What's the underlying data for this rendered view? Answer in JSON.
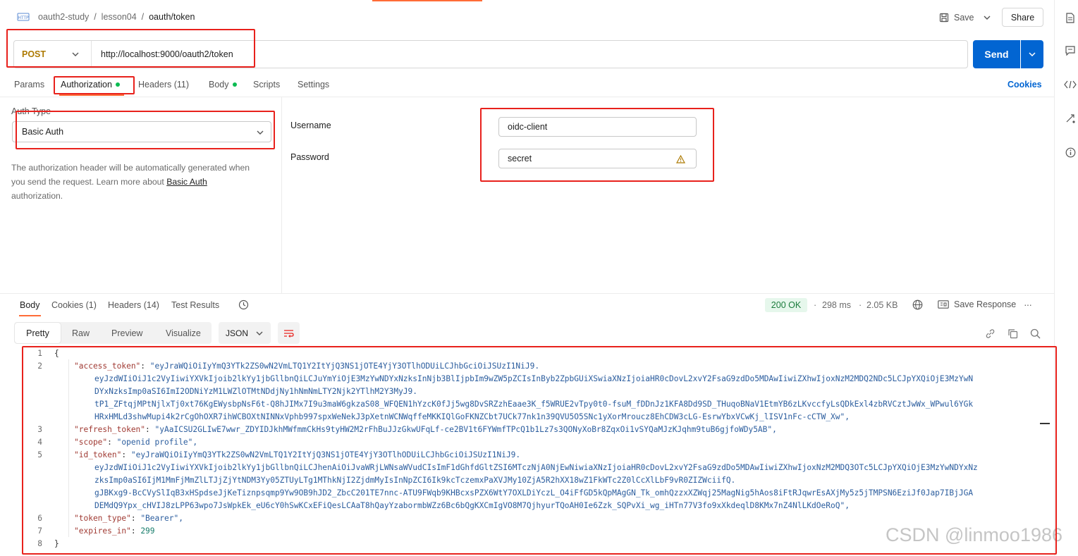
{
  "breadcrumb": {
    "collection": "oauth2-study",
    "folder": "lesson04",
    "request": "oauth/token",
    "http_badge": "HTTP"
  },
  "header": {
    "save_label": "Save",
    "share_label": "Share"
  },
  "request": {
    "method": "POST",
    "url": "http://localhost:9000/oauth2/token",
    "send_label": "Send"
  },
  "request_tabs": {
    "params": "Params",
    "authorization": "Authorization",
    "headers": "Headers (11)",
    "body": "Body",
    "scripts": "Scripts",
    "settings": "Settings",
    "cookies": "Cookies"
  },
  "auth": {
    "type_label": "Auth Type",
    "type_value": "Basic Auth",
    "description_1": "The authorization header will be automatically generated when",
    "description_2": "you send the request. Learn more about ",
    "description_link": "Basic Auth",
    "description_3": "authorization.",
    "username_label": "Username",
    "username_value": "oidc-client",
    "password_label": "Password",
    "password_value": "secret"
  },
  "response_tabs": {
    "body": "Body",
    "cookies": "Cookies (1)",
    "headers": "Headers (14)",
    "test_results": "Test Results"
  },
  "response_meta": {
    "status": "200 OK",
    "time": "298 ms",
    "size": "2.05 KB",
    "save_response": "Save Response",
    "more": "···"
  },
  "view_modes": {
    "pretty": "Pretty",
    "raw": "Raw",
    "preview": "Preview",
    "visualize": "Visualize",
    "format": "JSON"
  },
  "code": {
    "l1": "{",
    "access_token_key": "\"access_token\"",
    "access_token_1": "\"eyJraWQiOiIyYmQ3YTk2ZS0wN2VmLTQ1Y2ItYjQ3NS1jOTE4YjY3OTlhODUiLCJhbGciOiJSUzI1NiJ9.",
    "access_token_2": "eyJzdWIiOiJ1c2VyIiwiYXVkIjoib2lkYy1jbGllbnQiLCJuYmYiOjE3MzYwNDYxNzksInNjb3BlIjpbIm9wZW5pZCIsInByb2ZpbGUiXSwiaXNzIjoiaHR0cDovL2xvY2FsaG9zdDo5MDAwIiwiZXhwIjoxNzM2MDQ2NDc5LCJpYXQiOjE3MzYwN",
    "access_token_3": "DYxNzksImp0aSI6ImI2ODNiYzM1LWZlOTMtNDdjNy1hNmNmLTY2Njk2YTlhM2Y3MyJ9.",
    "access_token_4": "tP1_ZFtqjMPtNjlxTj0xt76KgEWysbpNsF6t-Q8hJIMx7I9u3maW6gkzaS08_WFQEN1hYzcK0fJj5wg8DvSRZzhEaae3K_f5WRUE2vTpy0t0-fsuM_fDDnJz1KFA8Dd9SD_THuqoBNaV1EtmYB6zLKvccfyLsQDkExl4zbRVCztJwWx_WPwul6YGk",
    "access_token_5": "HRxHMLd3shwMupi4k2rCgOhOXR7ihWCBOXtNINNxVphb997spxWeNekJ3pXetnWCNWqffeMKKIQlGoFKNZCbt7UCk77nk1n39QVU5O5SNc1yXorMroucz8EhCDW3cLG-EsrwYbxVCwKj_lISV1nFc-cCTW_Xw\",",
    "refresh_token_key": "\"refresh_token\"",
    "refresh_token": "\"yAaICSU2GLIwE7wwr_ZDYIDJkhMWfmmCkHs9tyHW2M2rFhBuJJzGkwUFqLf-ce2BV1t6FYWmfTPcQ1b1Lz7s3QONyXoBr8ZqxOi1vSYQaMJzKJqhm9tuB6gjfoWDy5AB\",",
    "scope_key": "\"scope\"",
    "scope": "\"openid profile\",",
    "id_token_key": "\"id_token\"",
    "id_token_1": "\"eyJraWQiOiIyYmQ3YTk2ZS0wN2VmLTQ1Y2ItYjQ3NS1jOTE4YjY3OTlhODUiLCJhbGciOiJSUzI1NiJ9.",
    "id_token_2": "eyJzdWIiOiJ1c2VyIiwiYXVkIjoib2lkYy1jbGllbnQiLCJhenAiOiJvaWRjLWNsaWVudCIsImF1dGhfdGltZSI6MTczNjA0NjEwNiwiaXNzIjoiaHR0cDovL2xvY2FsaG9zdDo5MDAwIiwiZXhwIjoxNzM2MDQ3OTc5LCJpYXQiOjE3MzYwNDYxNz",
    "id_token_3": "zksImp0aSI6IjM1MmFjMmZlLTJjZjYtNDM3Yy05ZTUyLTg1MThkNjI2ZjdmMyIsInNpZCI6Ik9kcTczemxPaXVJMy10ZjA5R2hXX18wZ1FkWTc2Z0lCcXlLbF9vR0ZIZWciifQ.",
    "id_token_4": "gJBKxg9-BcCVySlIqB3xHSpdseJjKeTiznpsqmp9Yw9OB9hJD2_ZbcC201TE7nnc-ATU9FWqb9KHBcxsPZX6WtY7OXLDiYczL_O4iFfGD5kQpMAgGN_Tk_omhQzzxXZWqj25MagNig5hAos8iFtRJqwrEsAXjMy5z5jTMPSN6EziJf0Jap7IBjJGA",
    "id_token_5": "DEMdQ9Ypx_cHVIJ8zLPP63wpo7JsWpkEk_eU6cY0hSwKCxEFiQesLCAaT8hQayYzabormbWZz6Bc6bQgKXCmIgVO8M7QjhyurTQoAH0Ie6Zzk_SQPvXi_wg_iHTn77V3fo9xXkdeqlD8KMx7nZ4NlLKdOeRoQ\",",
    "token_type_key": "\"token_type\"",
    "token_type": "\"Bearer\",",
    "expires_in_key": "\"expires_in\"",
    "expires_in": "299",
    "l8": "}"
  },
  "line_numbers": [
    "1",
    "2",
    "3",
    "4",
    "5",
    "6",
    "7",
    "8"
  ],
  "watermark": "CSDN @linmoo1986",
  "colors": {
    "accent": "#0265d2",
    "method": "#ad7a03",
    "annotation": "#e8211c",
    "status_bg": "#e6f7ec",
    "status_fg": "#1b7c3c"
  }
}
